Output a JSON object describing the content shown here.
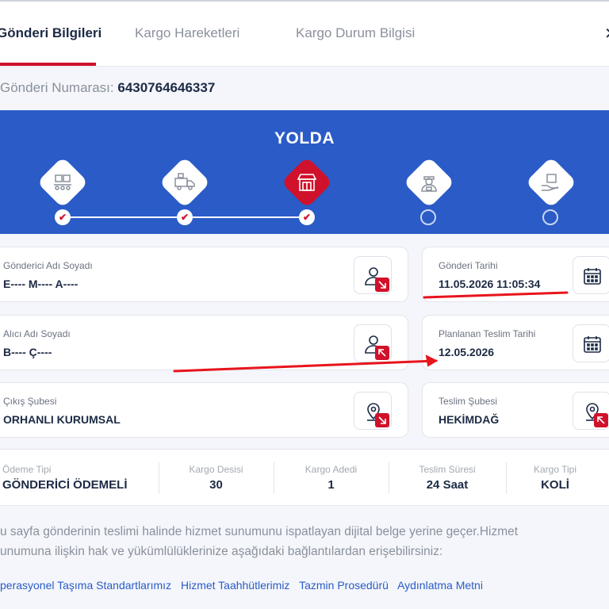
{
  "tabs": [
    {
      "label": "Gönderi Bilgileri",
      "active": true
    },
    {
      "label": "Kargo Hareketleri",
      "active": false
    },
    {
      "label": "Kargo Durum Bilgisi",
      "active": false
    }
  ],
  "close_glyph": "✕",
  "shipment": {
    "label": "Gönderi Numarası:",
    "number": "6430764646337"
  },
  "status": {
    "title": "YOLDA",
    "steps": [
      {
        "icon": "warehouse-conveyor-icon",
        "done": true
      },
      {
        "icon": "delivery-truck-icon",
        "done": true
      },
      {
        "icon": "branch-store-icon",
        "done": true,
        "current": true
      },
      {
        "icon": "courier-icon",
        "done": false
      },
      {
        "icon": "hand-package-icon",
        "done": false
      }
    ],
    "check_glyph": "✔"
  },
  "cards": {
    "sender": {
      "label": "Gönderici Adı Soyadı",
      "value": "E---- M---- A----",
      "icon": "person-icon"
    },
    "receiver": {
      "label": "Alıcı Adı Soyadı",
      "value": "B---- Ç----",
      "icon": "person-icon"
    },
    "origin_branch": {
      "label": "Çıkış Şubesi",
      "value": "ORHANLI KURUMSAL",
      "icon": "location-pin-icon"
    },
    "ship_date": {
      "label": "Gönderi Tarihi",
      "value": "11.05.2026 11:05:34",
      "icon": "calendar-icon"
    },
    "planned_delivery": {
      "label": "Planlanan Teslim Tarihi",
      "value": "12.05.2026",
      "icon": "calendar-icon"
    },
    "delivery_branch": {
      "label": "Teslim Şubesi",
      "value": "HEKİMDAĞ",
      "icon": "location-pin-icon"
    }
  },
  "summary": [
    {
      "label": "Ödeme Tipi",
      "value": "GÖNDERİCİ ÖDEMELİ"
    },
    {
      "label": "Kargo Desisi",
      "value": "30"
    },
    {
      "label": "Kargo Adedi",
      "value": "1"
    },
    {
      "label": "Teslim Süresi",
      "value": "24 Saat"
    },
    {
      "label": "Kargo Tipi",
      "value": "KOLİ"
    }
  ],
  "info": {
    "line1": "u sayfa gönderinin teslimi halinde hizmet sunumunu ispatlayan dijital belge yerine geçer.Hizmet",
    "line2": "unumuna ilişkin hak ve yükümlülüklerinize aşağıdaki bağlantılardan erişebilirsiniz:"
  },
  "links": [
    "perasyonel Taşıma Standartlarımız",
    "Hizmet Taahhütlerimiz",
    "Tazmin Prosedürü",
    "Aydınlatma Metni"
  ],
  "colors": {
    "brand_red": "#d0112b",
    "brand_blue": "#2a5bc7",
    "annotation_red": "#e8141c"
  }
}
